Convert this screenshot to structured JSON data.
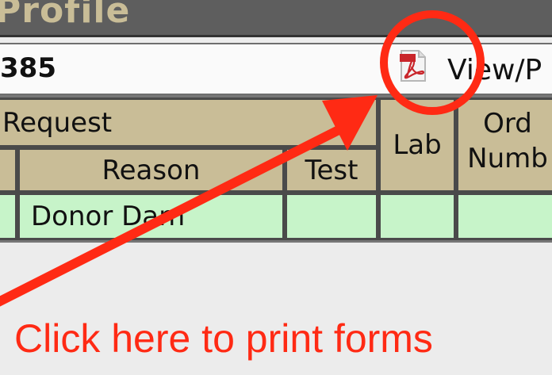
{
  "window": {
    "title": "Profile"
  },
  "record": {
    "id": "385",
    "view_print_label": "View/P"
  },
  "table": {
    "group_header": "Request",
    "headers": {
      "reason": "Reason",
      "test": "Test",
      "lab": "Lab",
      "order_line1": "Ord",
      "order_line2": "Numb"
    },
    "rows": [
      {
        "reason": "Donor Dam",
        "test": "",
        "lab": "",
        "order": ""
      }
    ]
  },
  "annotation": {
    "text": "Click here to print forms",
    "color": "#ff2a14"
  },
  "icons": {
    "pdf": "pdf-icon"
  }
}
